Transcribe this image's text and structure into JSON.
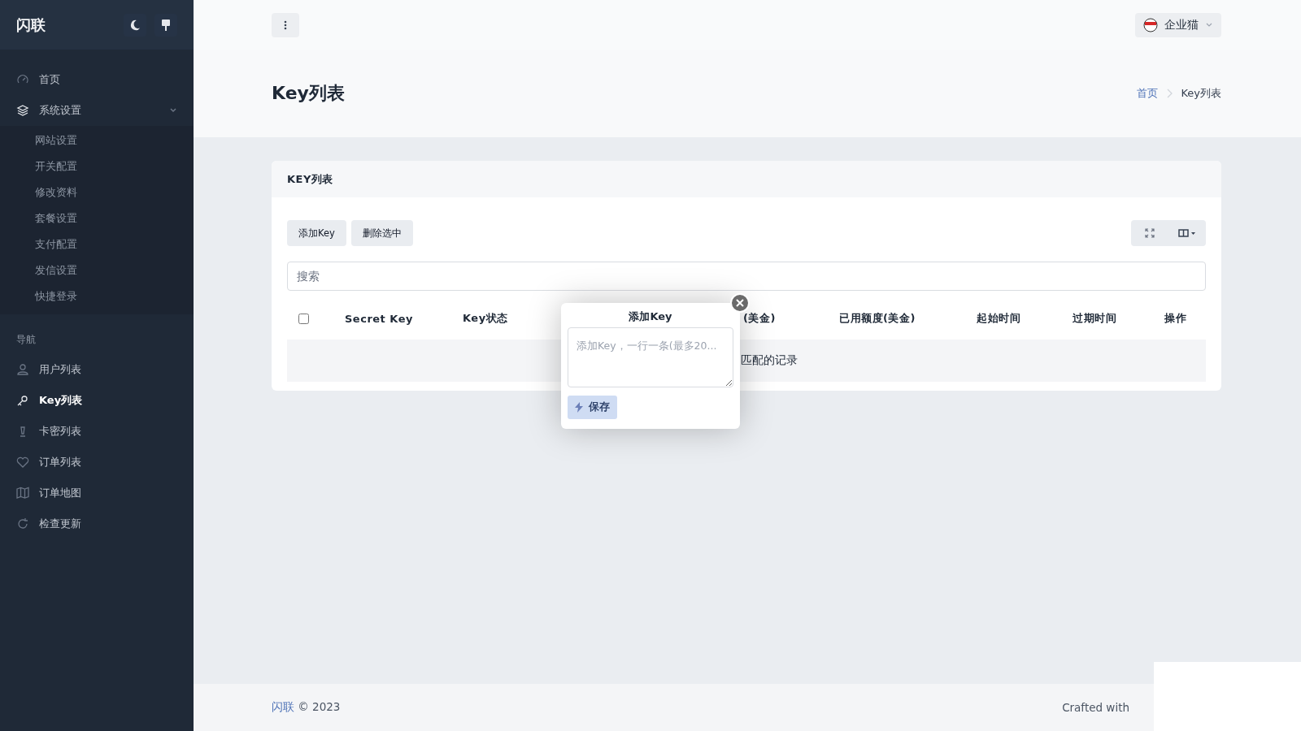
{
  "sidebar": {
    "brand": "闪联",
    "items": [
      {
        "kind": "link",
        "label": "首页",
        "selected": false
      },
      {
        "kind": "group",
        "label": "系统设置",
        "expanded": true,
        "selected": false,
        "children": [
          {
            "label": "网站设置"
          },
          {
            "label": "开关配置"
          },
          {
            "label": "修改资料"
          },
          {
            "label": "套餐设置"
          },
          {
            "label": "支付配置"
          },
          {
            "label": "发信设置"
          },
          {
            "label": "快捷登录"
          }
        ]
      },
      {
        "kind": "heading",
        "label": "导航"
      },
      {
        "kind": "link",
        "label": "用户列表",
        "selected": false
      },
      {
        "kind": "link",
        "label": "Key列表",
        "selected": true
      },
      {
        "kind": "link",
        "label": "卡密列表",
        "selected": false
      },
      {
        "kind": "link",
        "label": "订单列表",
        "selected": false
      },
      {
        "kind": "link",
        "label": "订单地图",
        "selected": false
      },
      {
        "kind": "link",
        "label": "检查更新",
        "selected": false
      }
    ]
  },
  "topbar": {
    "user": "企业猫"
  },
  "page": {
    "title": "Key列表",
    "breadcrumb": [
      {
        "label": "首页"
      },
      {
        "label": "Key列表"
      }
    ]
  },
  "card": {
    "title": "KEY列表",
    "buttons": [
      "添加Key",
      "删除选中"
    ],
    "search": {
      "placeholder": "搜索"
    },
    "select_all": {
      "checked": false
    },
    "columns": [
      "Secret Key",
      "Key状态",
      "(美金)",
      "已用额度(美金)",
      "起始时间",
      "过期时间",
      "操作"
    ],
    "empty_text": "匹配的记录"
  },
  "popover": {
    "title": "添加Key",
    "placeholder": "添加Key，一行一条(最多20...",
    "button": "保存"
  },
  "footer": {
    "brand": "闪联",
    "copyright": "© 2023",
    "credit": "Crafted with"
  }
}
